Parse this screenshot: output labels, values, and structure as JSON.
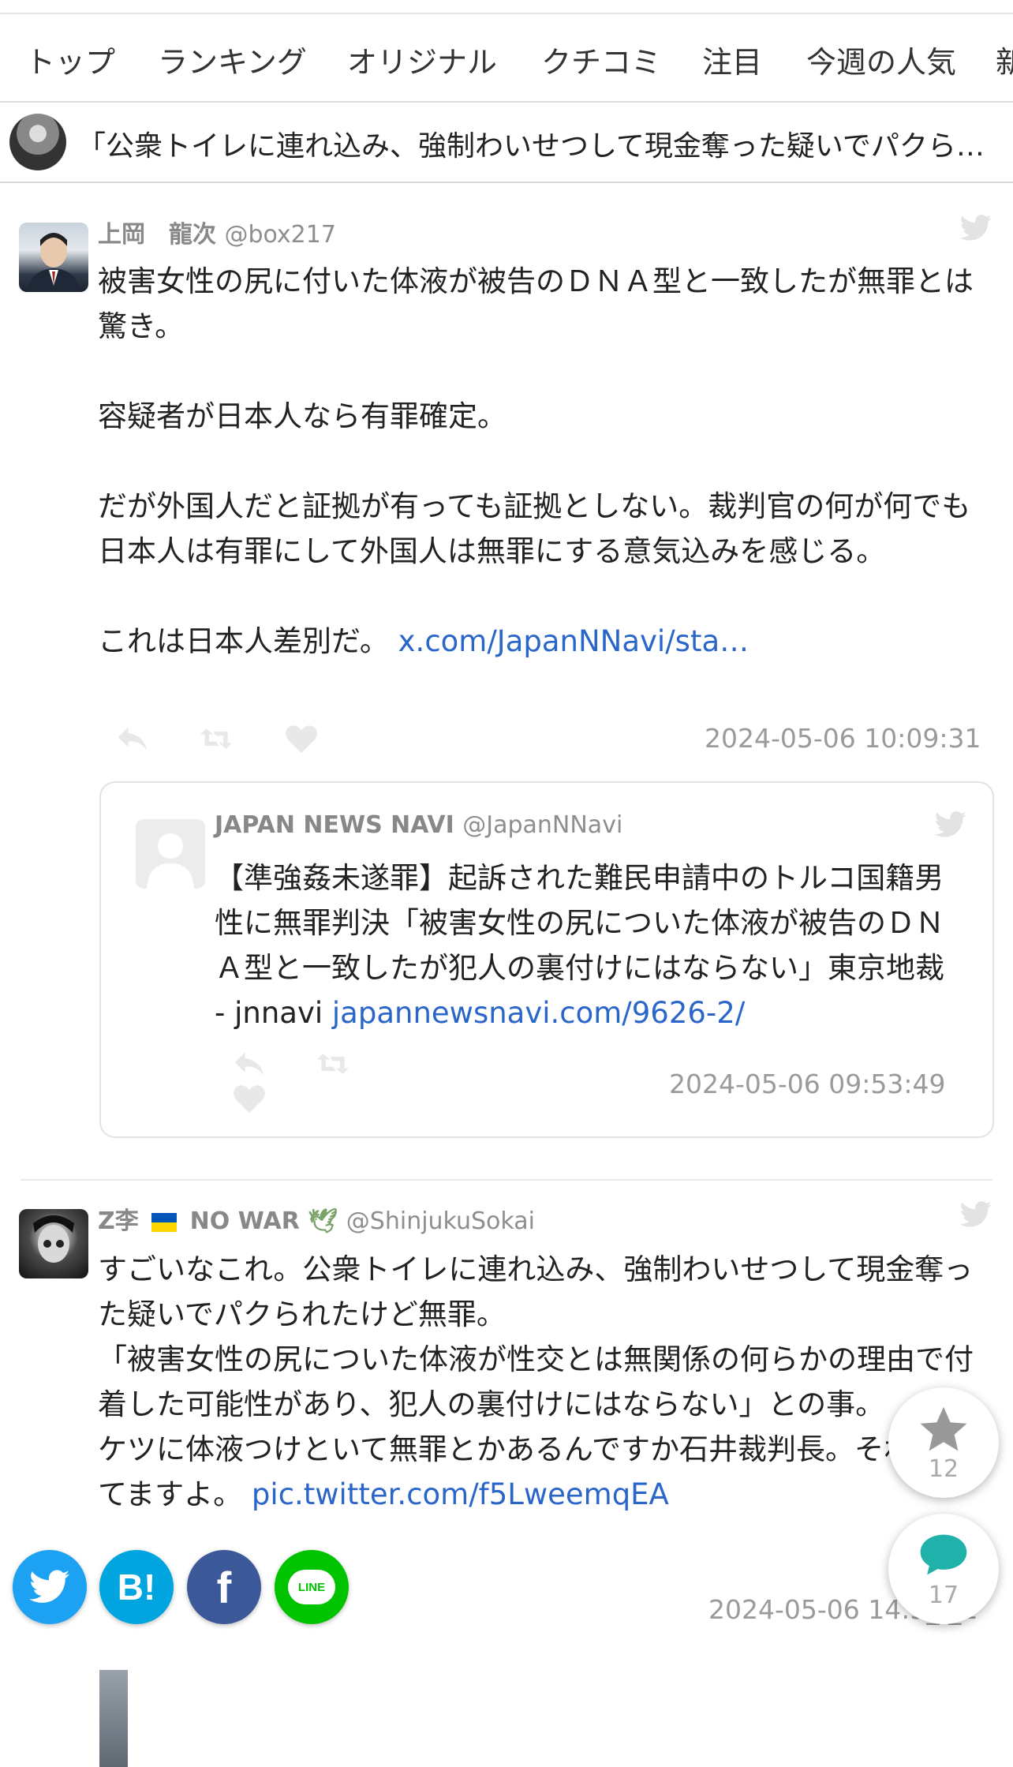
{
  "nav": {
    "items": [
      "トップ",
      "ランキング",
      "オリジナル",
      "クチコミ",
      "注目",
      "今週の人気",
      "新"
    ]
  },
  "article": {
    "title": "「公衆トイレに連れ込み、強制わいせつして現金奪った疑いでパクら…"
  },
  "tweets": [
    {
      "name": "上岡　龍次",
      "handle": "@box217",
      "text": "被害女性の尻に付いた体液が被告のＤＮＡ型と一致したが無罪とは驚き。\n\n容疑者が日本人なら有罪確定。\n\nだが外国人だと証拠が有っても証拠としない。裁判官の何が何でも日本人は有罪にして外国人は無罪にする意気込みを感じる。\n\nこれは日本人差別だ。 ",
      "link": "x.com/JapanNNavi/sta…",
      "timestamp": "2024-05-06 10:09:31"
    },
    {
      "name": "Z李",
      "name_suffix": "NO WAR",
      "handle": "@ShinjukuSokai",
      "text": "すごいなこれ。公衆トイレに連れ込み、強制わいせつして現金奪った疑いでパクられたけど無罪。\n「被害女性の尻についた体液が性交とは無関係の何らかの理由で付着した可能性があり、犯人の裏付けにはならない」との事。\nケツに体液つけといて無罪とかあるんですか石井裁判長。それやってますよ。 ",
      "link": "pic.twitter.com/f5LweemqEA",
      "timestamp": "2024-05-06 14:5_:_1"
    }
  ],
  "quote": {
    "name": "JAPAN NEWS NAVI",
    "handle": "@JapanNNavi",
    "text": "【準強姦未遂罪】起訴された難民申請中のトルコ国籍男性に無罪判決「被害女性の尻についた体液が被告のＤＮＡ型と一致したが犯人の裏付けにはならない」東京地裁 - jnnavi ",
    "link": "japannewsnavi.com/9626-2/",
    "timestamp": "2024-05-06 09:53:49"
  },
  "floating": {
    "favorites_count": "12",
    "comments_count": "17"
  },
  "share": {
    "hatena_label": "B!",
    "facebook_label": "f",
    "line_label": "LINE"
  },
  "colors": {
    "link": "#2a66c9",
    "twitter": "#1da1f2",
    "hatena": "#00a4de",
    "facebook": "#3b5998",
    "line": "#00c300",
    "comment": "#20b2aa"
  }
}
